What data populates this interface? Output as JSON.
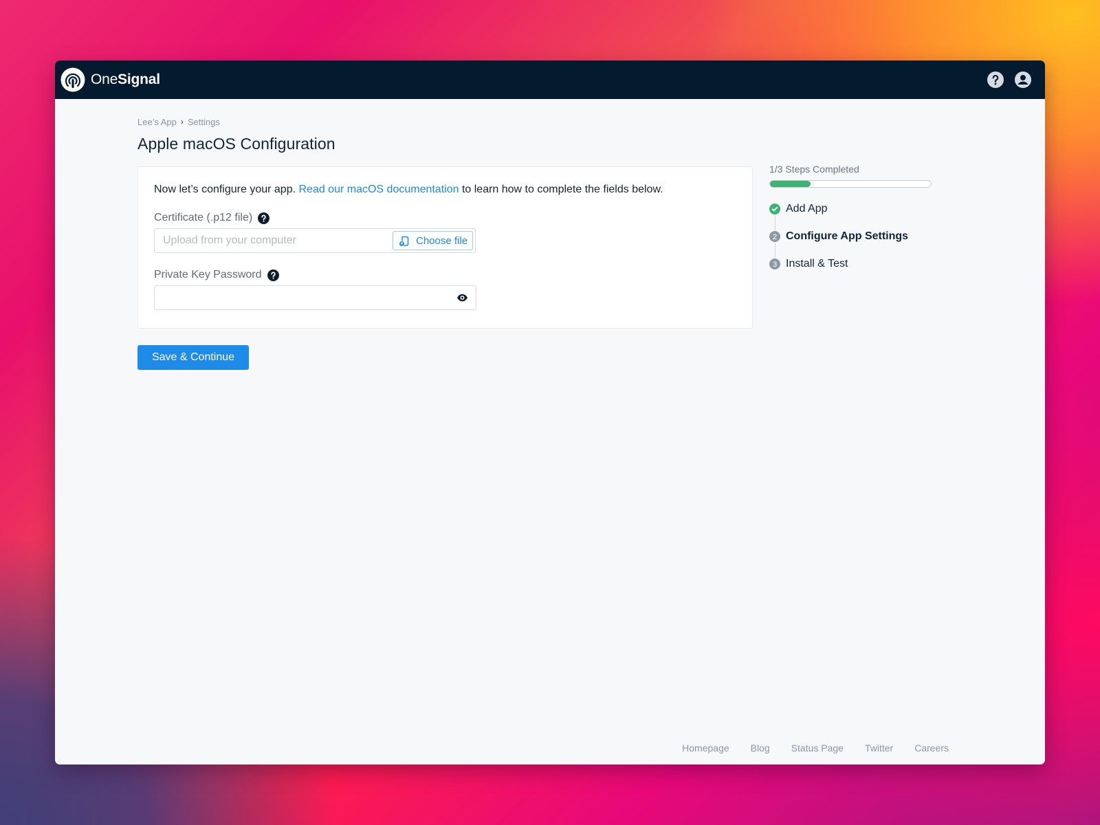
{
  "app": {
    "brand_one": "One",
    "brand_signal": "Signal"
  },
  "header": {
    "icons": [
      "help-icon",
      "account-icon"
    ]
  },
  "breadcrumb": {
    "items": [
      "Lee’s App",
      "Settings"
    ],
    "separator": "›"
  },
  "page": {
    "title": "Apple macOS Configuration"
  },
  "form": {
    "intro_before": "Now let’s configure your app. ",
    "intro_link": "Read our macOS documentation",
    "intro_after": " to learn how to complete the fields below.",
    "certificate": {
      "label": "Certificate (.p12 file)",
      "placeholder": "Upload from your computer",
      "choose_button": "Choose file"
    },
    "password": {
      "label": "Private Key Password",
      "value": ""
    },
    "submit_label": "Save & Continue"
  },
  "progress": {
    "label": "1/3 Steps Completed",
    "completed": 1,
    "total": 3,
    "fraction": 0.25,
    "color": "#3cb371",
    "steps": [
      {
        "number": "1",
        "label": "Add App",
        "status": "done"
      },
      {
        "number": "2",
        "label": "Configure App Settings",
        "status": "current"
      },
      {
        "number": "3",
        "label": "Install & Test",
        "status": "pending"
      }
    ]
  },
  "footer": {
    "links": [
      "Homepage",
      "Blog",
      "Status Page",
      "Twitter",
      "Careers"
    ]
  },
  "colors": {
    "topbar": "#041a2e",
    "accent": "#1f8be8",
    "success": "#3cb371"
  }
}
